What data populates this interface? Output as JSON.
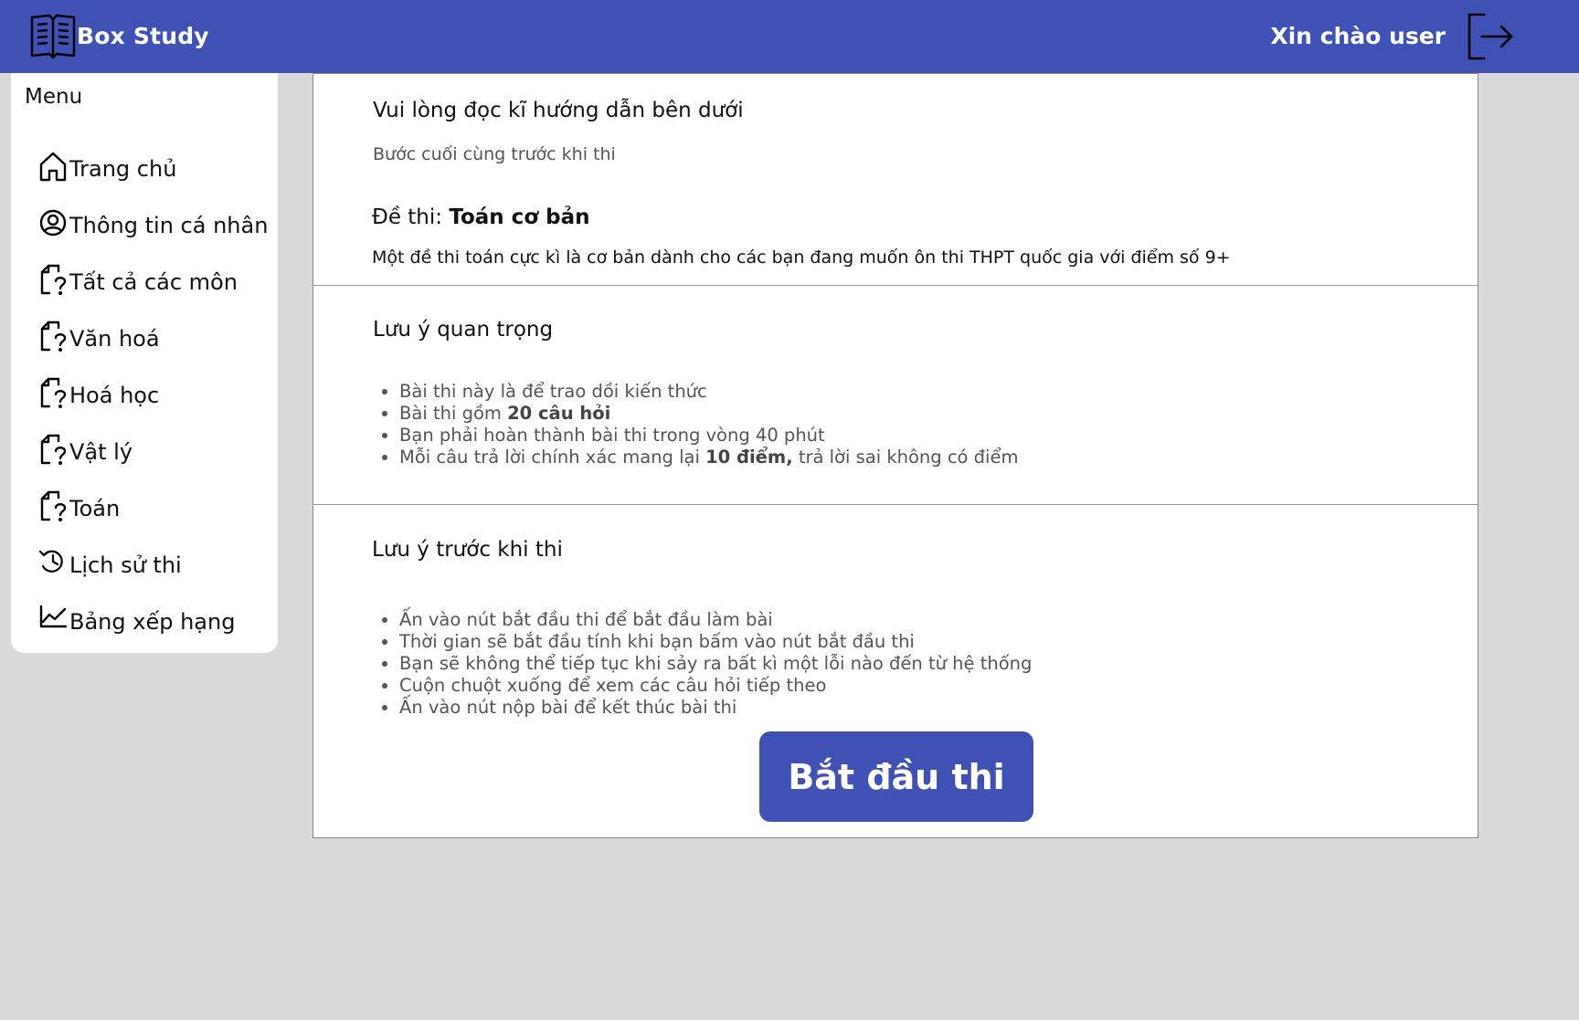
{
  "header": {
    "brand": "Box Study",
    "greeting": "Xin chào user",
    "brand_color": "#3f51b5"
  },
  "sidebar": {
    "title": "Menu",
    "items": [
      {
        "label": "Trang chủ",
        "icon": "home-icon"
      },
      {
        "label": "Thông tin cá nhân",
        "icon": "user-circle-icon"
      },
      {
        "label": "Tất cả các môn",
        "icon": "file-question-icon"
      },
      {
        "label": "Văn hoá",
        "icon": "file-question-icon"
      },
      {
        "label": "Hoá học",
        "icon": "file-question-icon"
      },
      {
        "label": "Vật lý",
        "icon": "file-question-icon"
      },
      {
        "label": "Toán",
        "icon": "file-question-icon"
      },
      {
        "label": "Lịch sử thi",
        "icon": "history-icon"
      },
      {
        "label": "Bảng xếp hạng",
        "icon": "chart-line-icon"
      }
    ]
  },
  "intro": {
    "title": "Vui lòng đọc kĩ hướng dẫn bên dưới",
    "subtitle": "Bước cuối cùng trước khi thi",
    "exam_prefix": "Đề thi:",
    "exam_name": "Toán cơ bản",
    "description": "Một đề thi toán cực kì là cơ bản dành cho các bạn đang muốn ôn thi THPT quốc gia với điểm số 9+"
  },
  "important": {
    "title": "Lưu ý quan trọng",
    "note1": "Bài thi này là để trao dồi kiến thức",
    "note2_prefix": "Bài thi gồm",
    "note2_bold": "20 câu hỏi",
    "note3": "Bạn phải hoàn thành bài thi trong vòng 40 phút",
    "note4_prefix": "Mỗi câu trả lời chính xác mang lại",
    "note4_bold": "10 điểm,",
    "note4_suffix": "trả lời sai không có điểm"
  },
  "before_exam": {
    "title": "Lưu ý trước khi thi",
    "notes": [
      "Ấn vào nút bắt đầu thi để bắt đầu làm bài",
      "Thời gian sẽ bắt đầu tính khi bạn bấm vào nút bắt đầu thi",
      "Bạn sẽ không thể tiếp tục khi sảy ra bất kì một lỗi nào đến từ hệ thống",
      "Cuộn chuột xuống để xem các câu hỏi tiếp theo",
      "Ấn vào nút nộp bài để kết thúc bài thi"
    ],
    "start_button": "Bắt đầu thi"
  }
}
